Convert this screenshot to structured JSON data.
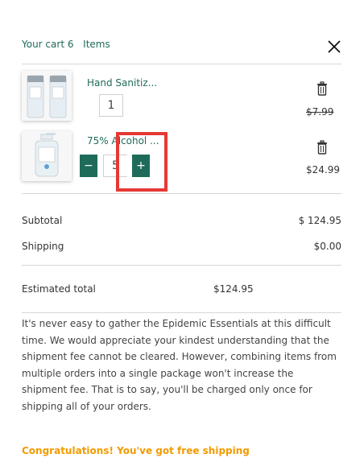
{
  "header": {
    "title_prefix": "Your cart",
    "item_count": "6",
    "items_word": "Items",
    "close_icon": "close-icon"
  },
  "items": [
    {
      "name": "Hand Sanitiz...",
      "quantity": "1",
      "price": "$7.99",
      "price_style": "strikethrough",
      "delete_icon": "trash-icon"
    },
    {
      "name": "75% Alcohol ...",
      "quantity": "5",
      "price": "$24.99",
      "decrement_label": "−",
      "increment_label": "+",
      "delete_icon": "trash-icon"
    }
  ],
  "summary": {
    "subtotal_label": "Subtotal",
    "subtotal_value": "$ 124.95",
    "shipping_label": "Shipping",
    "shipping_value": "$0.00",
    "estimated_label": "Estimated total",
    "estimated_value": "$124.95"
  },
  "notice": "It's never easy to gather the Epidemic Essentials at this difficult time. We would appreciate your kindest understanding that the shipment fee cannot be cleared. However, combining items from multiple orders into a single package won't increase the shipment fee. That is to say, you'll be charged only once for shipping all of your orders.",
  "free_shipping": "Congratulations! You've got free shipping",
  "colors": {
    "accent": "#1f6b5a",
    "highlight": "#e53935",
    "promo": "#f29b00"
  }
}
